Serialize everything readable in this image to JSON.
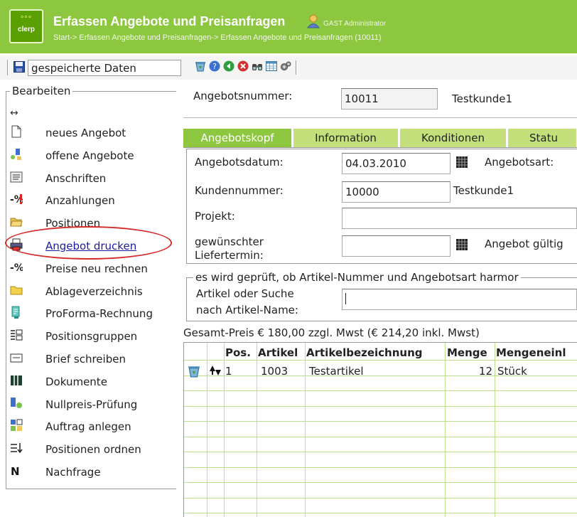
{
  "header": {
    "title": "Erfassen Angebote und Preisanfragen",
    "user": "GAST Administrator",
    "breadcrumb": "Start-> Erfassen Angebote und Preisanfragen-> Erfassen Angebote und Preisanfragen (10011)",
    "logo_text": "clerp",
    "bg_color": "#8dc63f"
  },
  "toolbar": {
    "saved_data_value": "gespeicherte Daten",
    "icons": [
      "save-icon",
      "recycle-icon",
      "help-icon",
      "back-icon",
      "delete-icon",
      "search-icon",
      "table-icon",
      "settings-icon"
    ]
  },
  "sidebar": {
    "legend": "Bearbeiten",
    "arrow": "↔",
    "items": [
      {
        "label": "neues Angebot",
        "icon": "new-document-icon"
      },
      {
        "label": "offene Angebote",
        "icon": "open-offers-icon"
      },
      {
        "label": "Anschriften",
        "icon": "address-icon"
      },
      {
        "label": "Anzahlungen",
        "icon": "down-payment-icon"
      },
      {
        "label": "Positionen",
        "icon": "folder-open-icon"
      },
      {
        "label": "Angebot drucken",
        "icon": "printer-icon"
      },
      {
        "label": "Preise neu rechnen",
        "icon": "recalculate-icon"
      },
      {
        "label": "Ablageverzeichnis",
        "icon": "folder-icon"
      },
      {
        "label": "ProForma-Rechnung",
        "icon": "invoice-icon"
      },
      {
        "label": "Positionsgruppen",
        "icon": "position-groups-icon"
      },
      {
        "label": "Brief schreiben",
        "icon": "letter-icon"
      },
      {
        "label": "Dokumente",
        "icon": "documents-icon"
      },
      {
        "label": "Nullpreis-Prüfung",
        "icon": "zero-price-check-icon"
      },
      {
        "label": "Auftrag anlegen",
        "icon": "create-order-icon"
      },
      {
        "label": "Positionen ordnen",
        "icon": "sort-positions-icon"
      },
      {
        "label": "Nachfrage",
        "icon": "inquiry-icon"
      }
    ],
    "highlight_color": "#d42a2a"
  },
  "offer": {
    "number_label": "Angebotsnummer:",
    "number_value": "10011",
    "customer_name": "Testkunde1"
  },
  "tabs": [
    {
      "label": "Angebotskopf",
      "active": true
    },
    {
      "label": "Information",
      "active": false
    },
    {
      "label": "Konditionen",
      "active": false
    },
    {
      "label": "Statu",
      "active": false
    }
  ],
  "form": {
    "date_label": "Angebotsdatum:",
    "date_value": "04.03.2010",
    "type_label": "Angebotsart:",
    "customer_number_label": "Kundennummer:",
    "customer_number_value": "10000",
    "customer_name": "Testkunde1",
    "project_label": "Projekt:",
    "project_value": "",
    "delivery_label_line1": "gewünschter",
    "delivery_label_line2": "Liefertermin:",
    "delivery_value": "",
    "valid_label": "Angebot gültig"
  },
  "check": {
    "legend": "es wird geprüft, ob Artikel-Nummer und Angebotsart harmor",
    "search_label_line1": "Artikel oder Suche",
    "search_label_line2": "nach Artikel-Name:",
    "search_value": ""
  },
  "totals": {
    "text": "Gesamt-Preis € 180,00 zzgl. Mwst   (€ 214,20 inkl. Mwst)"
  },
  "table": {
    "columns": [
      "Pos.",
      "Artikel",
      "Artikelbezeichnung",
      "Menge",
      "Mengeneinl"
    ],
    "rows": [
      {
        "pos": "1",
        "artikel": "1003",
        "bezeichnung": "Testartikel",
        "menge": "12",
        "einheit": "Stück"
      }
    ]
  }
}
